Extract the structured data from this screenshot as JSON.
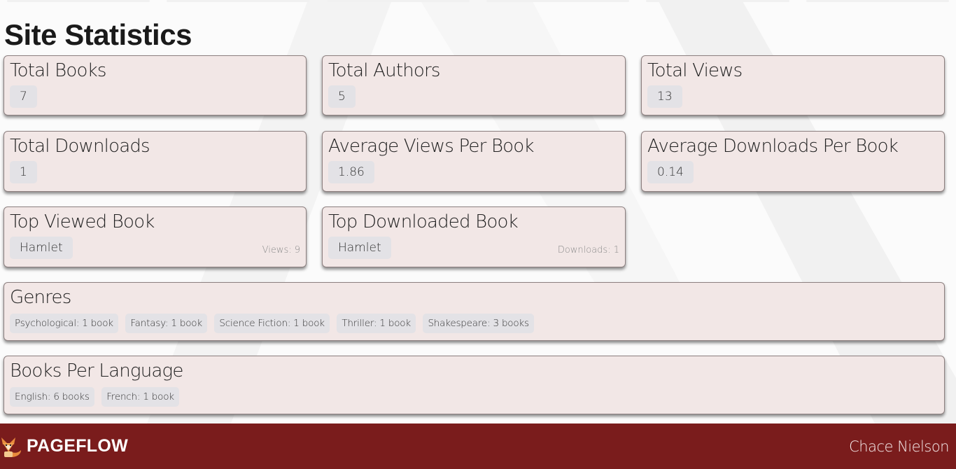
{
  "page": {
    "title": "Site Statistics"
  },
  "stats": {
    "total_books": {
      "label": "Total Books",
      "value": "7"
    },
    "total_authors": {
      "label": "Total Authors",
      "value": "5"
    },
    "total_views": {
      "label": "Total Views",
      "value": "13"
    },
    "total_downloads": {
      "label": "Total Downloads",
      "value": "1"
    },
    "avg_views": {
      "label": "Average Views Per Book",
      "value": "1.86"
    },
    "avg_downloads": {
      "label": "Average Downloads Per Book",
      "value": "0.14"
    },
    "top_viewed": {
      "label": "Top Viewed Book",
      "value": "Hamlet",
      "meta": "Views: 9"
    },
    "top_downloaded": {
      "label": "Top Downloaded Book",
      "value": "Hamlet",
      "meta": "Downloads: 1"
    }
  },
  "genres": {
    "label": "Genres",
    "items": [
      "Psychological: 1 book",
      "Fantasy: 1 book",
      "Science Fiction: 1 book",
      "Thriller: 1 book",
      "Shakespeare: 3 books"
    ]
  },
  "languages": {
    "label": "Books Per Language",
    "items": [
      "English: 6 books",
      "French: 1 book"
    ]
  },
  "footer": {
    "brand": "PAGEFLOW",
    "user": "Chace Nielson",
    "logo_icon": "fox-icon"
  },
  "colors": {
    "footer_bg": "#7a1c1c",
    "card_bg": "#f2e7e6",
    "pill_bg": "#e3e2e6"
  }
}
